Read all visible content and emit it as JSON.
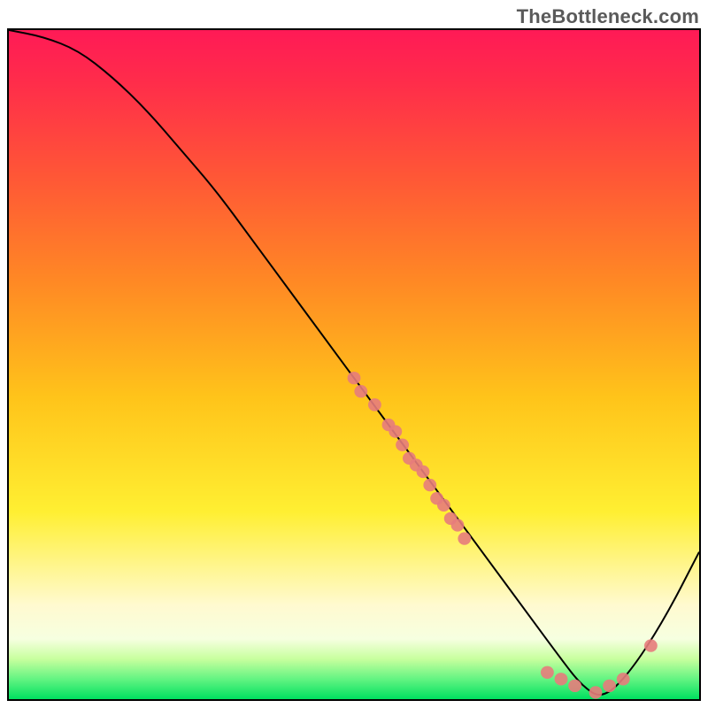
{
  "watermark": "TheBottleneck.com",
  "chart_data": {
    "type": "line",
    "title": "",
    "xlabel": "",
    "ylabel": "",
    "xlim": [
      0,
      100
    ],
    "ylim": [
      0,
      100
    ],
    "grid": false,
    "legend": false,
    "background": {
      "kind": "vertical-gradient",
      "stops": [
        {
          "pos": 0,
          "color": "#ff1a56"
        },
        {
          "pos": 22,
          "color": "#ff5736"
        },
        {
          "pos": 55,
          "color": "#ffc41a"
        },
        {
          "pos": 86,
          "color": "#fffad0"
        },
        {
          "pos": 97,
          "color": "#63f482"
        },
        {
          "pos": 100,
          "color": "#00e060"
        }
      ]
    },
    "series": [
      {
        "name": "bottleneck-curve",
        "color": "#000000",
        "x": [
          0,
          5,
          10,
          15,
          20,
          25,
          30,
          35,
          40,
          45,
          50,
          55,
          60,
          65,
          70,
          75,
          80,
          83,
          86,
          90,
          95,
          100
        ],
        "y": [
          100,
          99,
          97,
          93,
          88,
          82,
          76,
          69,
          62,
          55,
          48,
          41,
          34,
          27,
          20,
          13,
          6,
          2,
          0,
          4,
          12,
          22
        ]
      }
    ],
    "scatter": {
      "name": "sample-points",
      "color": "#e77c7c",
      "radius": 7,
      "points": [
        {
          "x": 50,
          "y": 48
        },
        {
          "x": 51,
          "y": 46
        },
        {
          "x": 53,
          "y": 44
        },
        {
          "x": 55,
          "y": 41
        },
        {
          "x": 56,
          "y": 40
        },
        {
          "x": 57,
          "y": 38
        },
        {
          "x": 58,
          "y": 36
        },
        {
          "x": 59,
          "y": 35
        },
        {
          "x": 60,
          "y": 34
        },
        {
          "x": 61,
          "y": 32
        },
        {
          "x": 62,
          "y": 30
        },
        {
          "x": 63,
          "y": 29
        },
        {
          "x": 64,
          "y": 27
        },
        {
          "x": 65,
          "y": 26
        },
        {
          "x": 66,
          "y": 24
        },
        {
          "x": 78,
          "y": 4
        },
        {
          "x": 80,
          "y": 3
        },
        {
          "x": 82,
          "y": 2
        },
        {
          "x": 85,
          "y": 1
        },
        {
          "x": 87,
          "y": 2
        },
        {
          "x": 89,
          "y": 3
        },
        {
          "x": 93,
          "y": 8
        }
      ]
    }
  }
}
